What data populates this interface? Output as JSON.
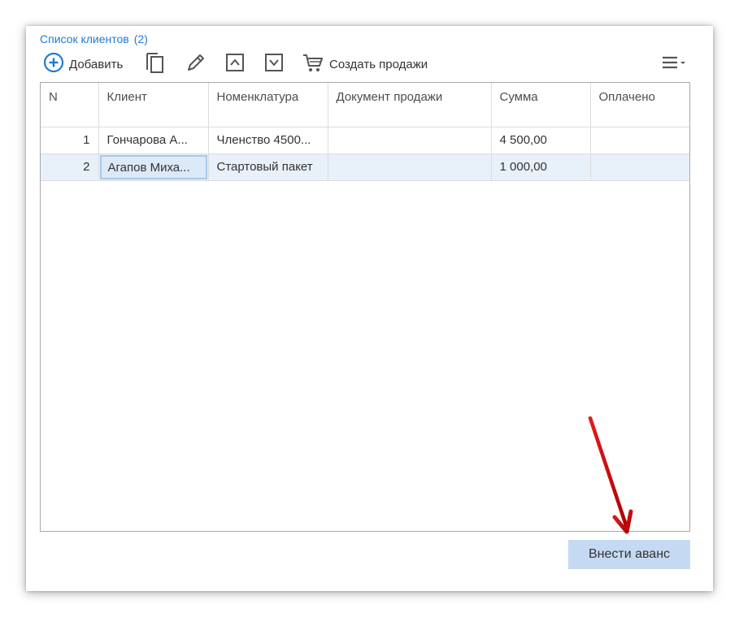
{
  "form": {
    "title": "Список клиентов",
    "count": "(2)"
  },
  "toolbar": {
    "add_label": "Добавить",
    "create_sales_label": "Создать продажи",
    "icons": [
      "add-circle-icon",
      "copy-icon",
      "pencil-icon",
      "move-up-icon",
      "move-down-icon",
      "cart-icon",
      "menu-icon"
    ]
  },
  "table": {
    "columns": [
      "N",
      "Клиент",
      "Номенклатура",
      "Документ продажи",
      "Сумма",
      "Оплачено"
    ],
    "rows": [
      {
        "n": "1",
        "client": "Гончарова А...",
        "item": "Членство 4500...",
        "doc": "",
        "sum": "4 500,00",
        "paid": ""
      },
      {
        "n": "2",
        "client": "Агапов Миха...",
        "item": "Стартовый пакет",
        "doc": "",
        "sum": "1 000,00",
        "paid": ""
      }
    ],
    "selected_row": 2
  },
  "footer": {
    "deposit_label": "Внести аванс"
  },
  "colors": {
    "accent": "#1f7ad6",
    "selected_row": "#e8f0fa",
    "button": "#c5daf2",
    "annotation_arrow": "#cc0000"
  }
}
